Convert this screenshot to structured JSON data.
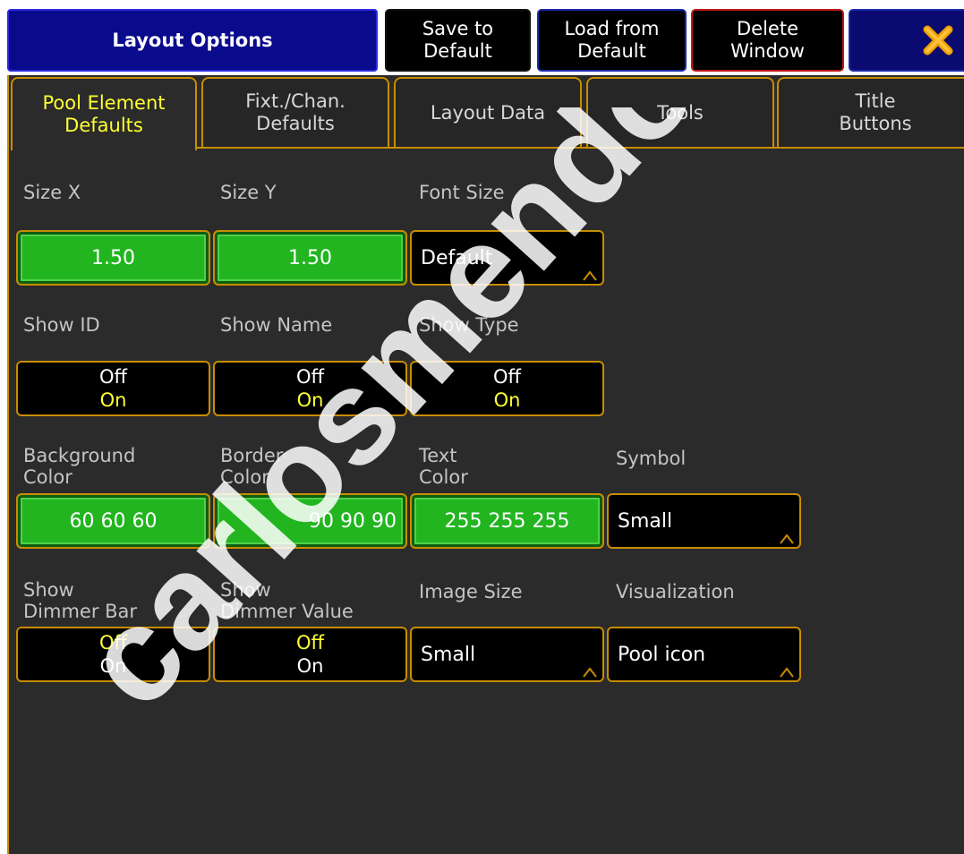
{
  "title": "Layout Options",
  "header_buttons": {
    "save": [
      "Save to",
      "Default"
    ],
    "load": [
      "Load from",
      "Default"
    ],
    "delete": [
      "Delete",
      "Window"
    ],
    "close_icon": "close-icon"
  },
  "tabs": [
    {
      "lines": [
        "Pool Element",
        "Defaults"
      ],
      "active": true
    },
    {
      "lines": [
        "Fixt./Chan.",
        "Defaults"
      ],
      "active": false
    },
    {
      "lines": [
        "Layout Data"
      ],
      "active": false
    },
    {
      "lines": [
        "Tools"
      ],
      "active": false
    },
    {
      "lines": [
        "Title",
        "Buttons"
      ],
      "active": false
    }
  ],
  "fields": {
    "size_x": {
      "label": "Size X",
      "value": "1.50"
    },
    "size_y": {
      "label": "Size Y",
      "value": "1.50"
    },
    "font_size": {
      "label": "Font Size",
      "value": "Default"
    },
    "show_id": {
      "label": "Show ID",
      "off": "Off",
      "on": "On",
      "selected": "On"
    },
    "show_name": {
      "label": "Show Name",
      "off": "Off",
      "on": "On",
      "selected": "On"
    },
    "show_type": {
      "label": "Show Type",
      "off": "Off",
      "on": "On",
      "selected": "On"
    },
    "background_color": {
      "label": [
        "Background",
        "Color"
      ],
      "value": "60 60 60"
    },
    "border_color": {
      "label": [
        "Border",
        "Color"
      ],
      "value": "90 90 90"
    },
    "text_color": {
      "label": [
        "Text",
        "Color"
      ],
      "value": "255 255 255"
    },
    "symbol": {
      "label": "Symbol",
      "value": "Small"
    },
    "show_dimmer_bar": {
      "label": [
        "Show",
        "Dimmer Bar"
      ],
      "off": "Off",
      "on": "On",
      "selected": "Off"
    },
    "show_dimmer_value": {
      "label": [
        "Show",
        "Dimmer Value"
      ],
      "off": "Off",
      "on": "On",
      "selected": "Off"
    },
    "image_size": {
      "label": "Image Size",
      "value": "Small"
    },
    "visualization": {
      "label": "Visualization",
      "value": "Pool icon"
    }
  },
  "watermark": "carlosmendoza.com",
  "colors": {
    "accent_border": "#c88d00",
    "title_bg": "#0a0a8c",
    "selected_text": "#ffff33",
    "value_green": "#22b520"
  }
}
